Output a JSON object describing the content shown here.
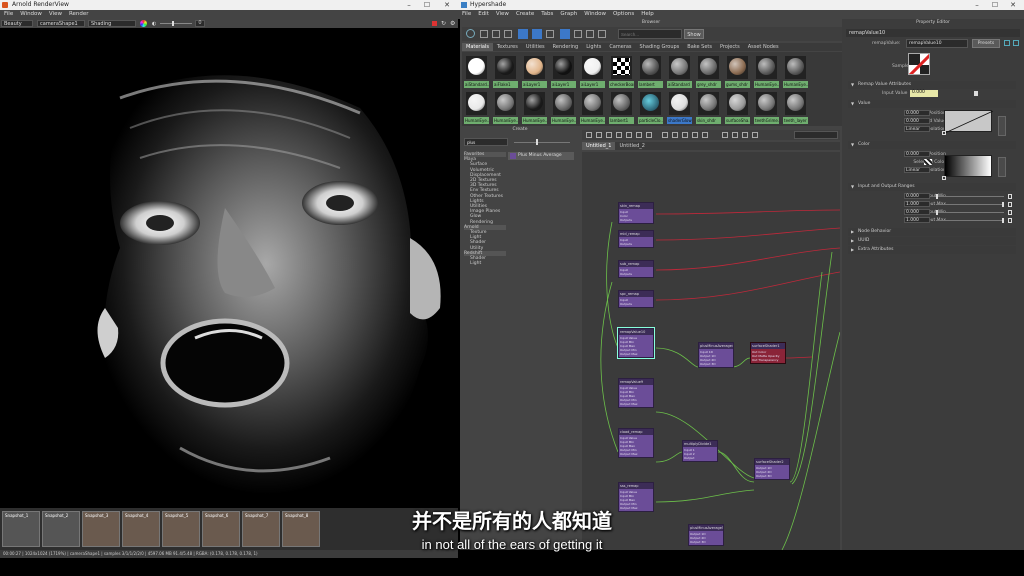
{
  "render_view": {
    "title": "Arnold RenderView",
    "menu": [
      "File",
      "Window",
      "View",
      "Render"
    ],
    "aov_select": "Beauty",
    "camera_select": "cameraShape1",
    "shading_select": "Shading",
    "zoom_value": "0",
    "snapshots": [
      "Snapshot_1",
      "Snapshot_2",
      "Snapshot_3",
      "Snapshot_4",
      "Snapshot_5",
      "Snapshot_6",
      "Snapshot_7",
      "Snapshot_8"
    ],
    "status": "00:00:27 | 1024x1024 (1719%) | cameraShape1 | samples 3/1/1/2/2/0 | 4597.06 MB 91.4/5.48 | RGBA: (0.178, 0.178, 0.178, 1)"
  },
  "hypershade": {
    "title": "Hypershade",
    "menu": [
      "File",
      "Edit",
      "View",
      "Create",
      "Tabs",
      "Graph",
      "Window",
      "Options",
      "Help"
    ],
    "browser_title": "Browser",
    "search_placeholder": "Search...",
    "show_button": "Show",
    "tabs": [
      "Materials",
      "Textures",
      "Utilities",
      "Rendering",
      "Lights",
      "Cameras",
      "Shading Groups",
      "Bake Sets",
      "Projects",
      "Asset Nodes"
    ],
    "swatches_row1": [
      "aiStandard...",
      "aiFlake1",
      "aiLayer1",
      "aiLayer1",
      "aiLayer1",
      "checkerBoard",
      "lambert",
      "aiStandard",
      "grey_shdr",
      "gums_shdr",
      "HumanEye...",
      "HumanEye..."
    ],
    "swatches_row2": [
      "HumanEye...",
      "HumanEye...",
      "HumanEye...",
      "HumanEye...",
      "HumanEye...",
      "lambert1",
      "particleClo...",
      "shaderGlow1",
      "skin_shdr",
      "surfaceSha...",
      "teethGrime...",
      "teeth_layer"
    ],
    "create_title": "Create",
    "create_search": "plus",
    "create_tree": [
      "Favorites",
      "Maya",
      "Surface",
      "Volumetric",
      "Displacement",
      "2D Textures",
      "3D Textures",
      "Env Textures",
      "Other Textures",
      "Lights",
      "Utilities",
      "Image Planes",
      "Glow",
      "Rendering",
      "Arnold",
      "Texture",
      "Light",
      "Shader",
      "Utility",
      "Redshift",
      "Shader",
      "Light"
    ],
    "create_result": "Plus Minus Average",
    "editor_tabs": [
      "Untitled_1",
      "Untitled_2"
    ],
    "nodes": [
      {
        "title": "skin_remap",
        "attrs": [
          "Input",
          "Color",
          "Outputs"
        ]
      },
      {
        "title": "mid_remap",
        "attrs": [
          "Input",
          "Outputs"
        ]
      },
      {
        "title": "sub_remap",
        "attrs": [
          "Input",
          "Outputs"
        ]
      },
      {
        "title": "spc_remap",
        "attrs": [
          "Input",
          "Outputs"
        ]
      },
      {
        "title": "remapValue10",
        "attrs": [
          "Input Value",
          "Input Min",
          "Input Max",
          "Output Min",
          "Output Max"
        ]
      },
      {
        "title": "plusMinusAverage4",
        "attrs": [
          "Input 1D",
          "Output 1D",
          "Output 2D",
          "Output 3D"
        ]
      },
      {
        "title": "surfaceShader1",
        "attrs": [
          "Out Color",
          "Out Matte Opacity",
          "Out Transparency"
        ]
      },
      {
        "title": "remapValue9",
        "attrs": [
          "Input Value",
          "Input Min",
          "Input Max",
          "Output Min",
          "Output Max"
        ]
      },
      {
        "title": "cload_remap",
        "attrs": [
          "Input Value",
          "Input Min",
          "Input Max",
          "Output Min",
          "Output Max"
        ]
      },
      {
        "title": "multiplyDivide1",
        "attrs": [
          "Input 1",
          "Input 2",
          "Output"
        ]
      },
      {
        "title": "surfaceShader2",
        "attrs": [
          "Output 1D",
          "Output 2D",
          "Output 3D"
        ]
      },
      {
        "title": "sss_remap",
        "attrs": [
          "Input Value",
          "Input Min",
          "Input Max",
          "Output Min",
          "Output Max"
        ]
      },
      {
        "title": "plusMinusAverage5",
        "attrs": [
          "Output 1D",
          "Output 2D",
          "Output 3D"
        ]
      }
    ]
  },
  "property_editor": {
    "title": "Property Editor",
    "node_name": "remapValue10",
    "remap_label": "remapValue:",
    "remap_value": "remapValue10",
    "presets_button": "Presets",
    "sample_label": "Sample",
    "sections": {
      "remap_attrs": "Remap Value Attributes",
      "value": "Value",
      "color": "Color",
      "input_output": "Input and Output Ranges",
      "node_behavior": "Node Behavior",
      "uuid": "UUID",
      "extra": "Extra Attributes"
    },
    "input_value_label": "Input Value",
    "input_value": "0.000",
    "value_rows": [
      {
        "label": "Selected Position",
        "value": "0.000"
      },
      {
        "label": "Selected Value",
        "value": "0.000"
      },
      {
        "label": "Interpolation",
        "value": "Linear"
      }
    ],
    "color_rows": [
      {
        "label": "Selected Position",
        "value": "0.000"
      },
      {
        "label": "Selected Color",
        "value": ""
      },
      {
        "label": "Interpolation",
        "value": "Linear"
      }
    ],
    "range_rows": [
      {
        "label": "Input Min",
        "value": "0.000"
      },
      {
        "label": "Input Max",
        "value": "1.000"
      },
      {
        "label": "Output Min",
        "value": "0.000"
      },
      {
        "label": "Output Max",
        "value": "1.000"
      }
    ]
  },
  "subtitle": {
    "chinese": "并不是所有的人都知道",
    "english": "in not all of the ears of getting it"
  },
  "colors": {
    "swatch_label_green": "#6fae6f",
    "node_purple": "#6b4d98",
    "node_red": "#8a2438",
    "wire_red": "#c0283a",
    "wire_green": "#6cc04a",
    "selection_blue": "#3c78c8"
  }
}
